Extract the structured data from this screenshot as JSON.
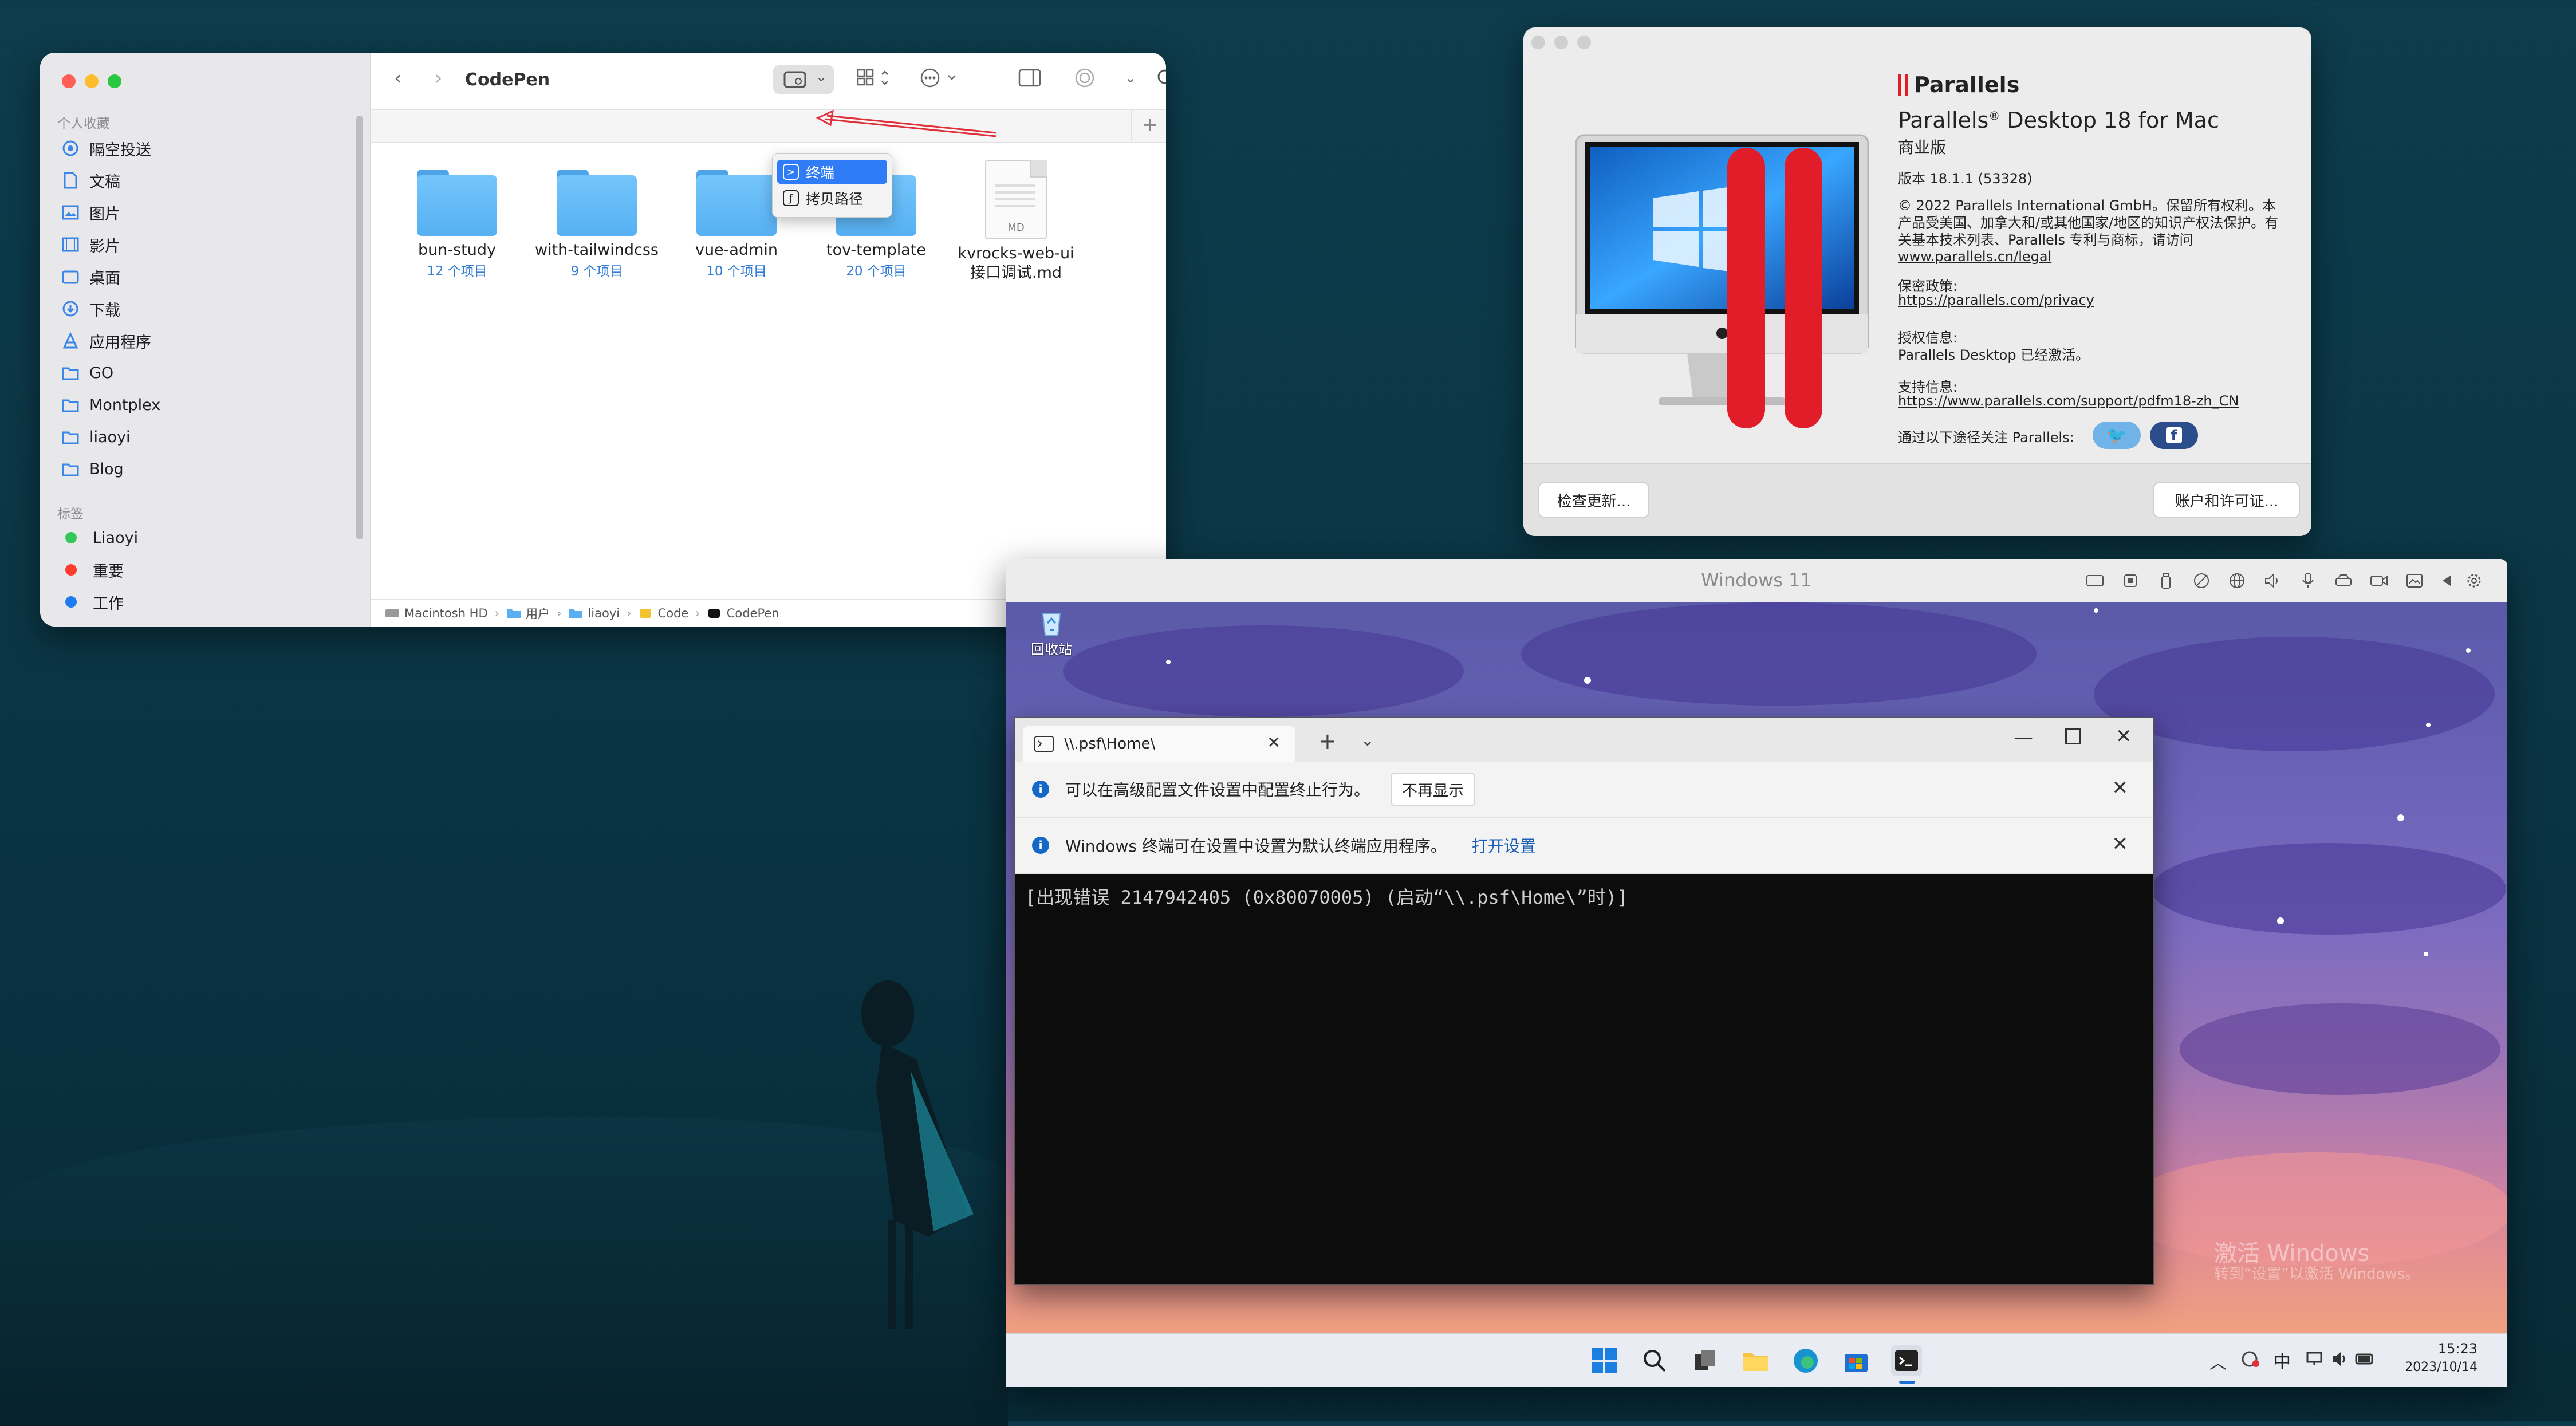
{
  "finder": {
    "title": "CodePen",
    "favorites_header": "个人收藏",
    "tags_header": "标签",
    "sidebar": [
      {
        "label": "隔空投送",
        "icon": "airdrop-icon"
      },
      {
        "label": "文稿",
        "icon": "document-icon"
      },
      {
        "label": "图片",
        "icon": "photo-icon"
      },
      {
        "label": "影片",
        "icon": "film-icon"
      },
      {
        "label": "桌面",
        "icon": "desktop-icon"
      },
      {
        "label": "下载",
        "icon": "download-icon"
      },
      {
        "label": "应用程序",
        "icon": "apps-icon"
      },
      {
        "label": "GO",
        "icon": "folder-icon"
      },
      {
        "label": "Montplex",
        "icon": "folder-icon"
      },
      {
        "label": "liaoyi",
        "icon": "folder-icon"
      },
      {
        "label": "Blog",
        "icon": "folder-icon"
      }
    ],
    "tags": [
      {
        "label": "Liaoyi",
        "color": "#34c759"
      },
      {
        "label": "重要",
        "color": "#ff3b30"
      },
      {
        "label": "工作",
        "color": "#1e7cf2"
      }
    ],
    "files": [
      {
        "name": "bun-study",
        "count": "12 个项目",
        "type": "folder"
      },
      {
        "name": "with-tailwindcss",
        "count": "9 个项目",
        "type": "folder"
      },
      {
        "name": "vue-admin",
        "count": "10 个项目",
        "type": "folder"
      },
      {
        "name": "tov-template",
        "count": "20 个项目",
        "type": "folder"
      },
      {
        "name": "kvrocks-web-ui",
        "name2": "接口调试.md",
        "type": "md",
        "badge": "MD"
      }
    ],
    "dropdown": {
      "item1": "终端",
      "item2": "拷贝路径"
    },
    "path": [
      "Macintosh HD",
      "用户",
      "liaoyi",
      "Code",
      "CodePen"
    ]
  },
  "about": {
    "brand": "Parallels",
    "product_a": "Parallels",
    "product_sup": "®",
    "product_b": " Desktop 18 for Mac",
    "edition": "商业版",
    "version": "版本 18.1.1 (53328)",
    "copyright": "© 2022 Parallels International GmbH。保留所有权利。本产品受美国、加拿大和/或其他国家/地区的知识产权法保护。有关基本技术列表、Parallels 专利与商标，请访问",
    "legal_link": "www.parallels.cn/legal",
    "privacy_label": "保密政策:",
    "privacy_link": "https://parallels.com/privacy",
    "license_label": "授权信息:",
    "license_text": "Parallels Desktop 已经激活。",
    "support_label": "支持信息:",
    "support_link": "https://www.parallels.com/support/pdfm18-zh_CN",
    "follow": "通过以下途径关注 Parallels:",
    "check_updates": "检查更新...",
    "account": "账户和许可证..."
  },
  "vm": {
    "title": "Windows 11",
    "recycle": "回收站",
    "watermark1": "激活 Windows",
    "watermark2": "转到“设置”以激活 Windows。",
    "time": "15:23",
    "date": "2023/10/14",
    "ime": "中"
  },
  "terminal": {
    "tab_title": "\\\\.psf\\Home\\",
    "info1": "可以在高级配置文件设置中配置终止行为。",
    "info1_button": "不再显示",
    "info2": "Windows 终端可在设置中设置为默认终端应用程序。",
    "info2_link": "打开设置",
    "output": "[出现错误 2147942405 (0x80070005) (启动“\\\\.psf\\Home\\”时)]"
  }
}
